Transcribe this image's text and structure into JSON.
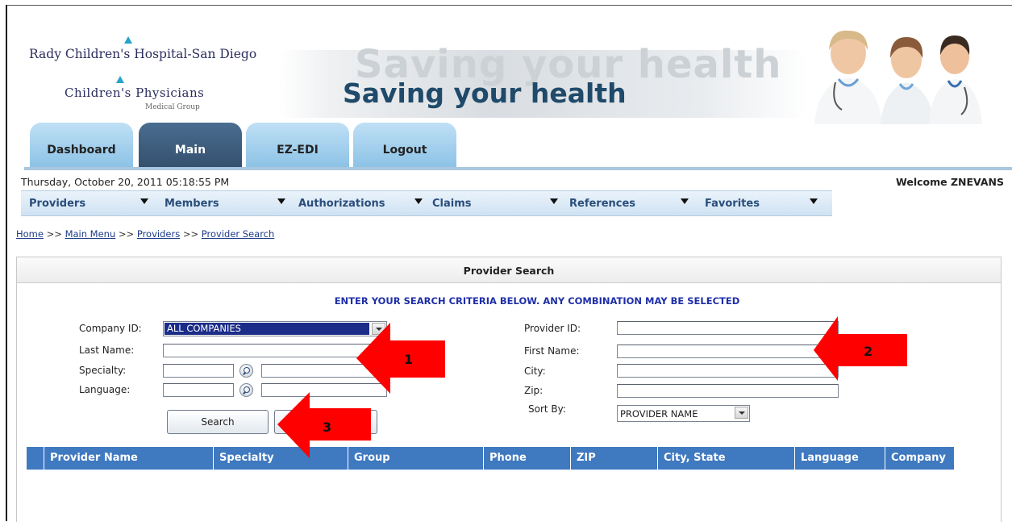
{
  "header": {
    "logo_line1": "Rady Children's Hospital-San Diego",
    "logo_line2": "Children's Physicians",
    "logo_line3": "Medical Group",
    "slogan": "Saving your health",
    "slogan_ghost": "Saving your health"
  },
  "tabs": [
    {
      "label": "Dashboard"
    },
    {
      "label": "Main"
    },
    {
      "label": "EZ-EDI"
    },
    {
      "label": "Logout"
    }
  ],
  "status": {
    "datetime": "Thursday, October 20, 2011 05:18:55 PM",
    "welcome": "Welcome ZNEVANS"
  },
  "menu": [
    {
      "label": "Providers"
    },
    {
      "label": "Members"
    },
    {
      "label": "Authorizations"
    },
    {
      "label": "Claims"
    },
    {
      "label": "References"
    },
    {
      "label": "Favorites"
    }
  ],
  "breadcrumb": {
    "home": "Home",
    "main": "Main Menu",
    "providers": "Providers",
    "current": "Provider Search",
    "sep": ">>"
  },
  "panel": {
    "title": "Provider Search",
    "instruction": "ENTER YOUR SEARCH CRITERIA BELOW. ANY COMBINATION MAY BE SELECTED"
  },
  "form": {
    "company_label": "Company ID:",
    "company_value": "ALL COMPANIES",
    "lastname_label": "Last Name:",
    "specialty_label": "Specialty:",
    "language_label": "Language:",
    "providerid_label": "Provider ID:",
    "firstname_label": "First Name:",
    "city_label": "City:",
    "zip_label": "Zip:",
    "sortby_label": "Sort By:",
    "sortby_value": "PROVIDER NAME",
    "search_button": "Search",
    "clear_button": ""
  },
  "grid": {
    "columns": [
      "Provider Name",
      "Specialty",
      "Group",
      "Phone",
      "ZIP",
      "City, State",
      "Language",
      "Company"
    ]
  },
  "annotations": {
    "arrow1": "1",
    "arrow2": "2",
    "arrow3": "3",
    "color": "#ff0000"
  }
}
